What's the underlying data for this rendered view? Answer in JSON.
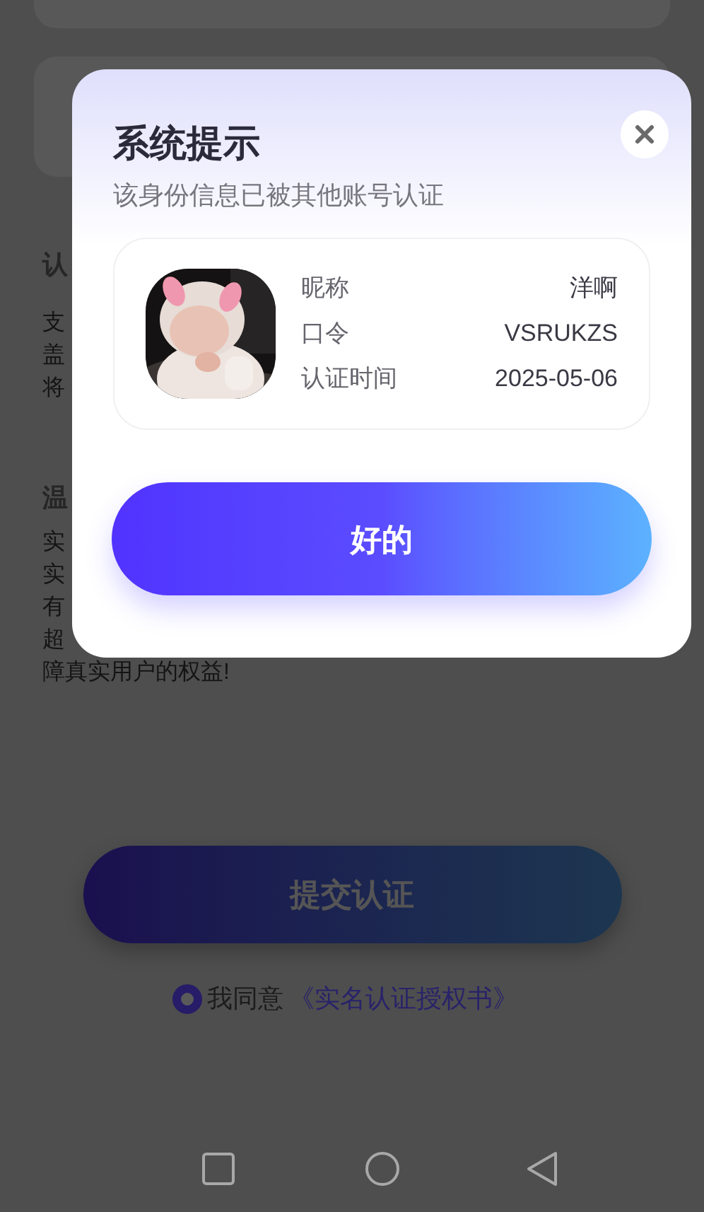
{
  "background": {
    "section_1": {
      "heading": "认",
      "lines": [
        "支",
        "盖",
        "将"
      ]
    },
    "section_2": {
      "heading": "温",
      "lines": [
        "实",
        "实",
        "有",
        "超",
        "障真实用户的权益!"
      ]
    },
    "submit_button": "提交认证",
    "agreement": {
      "checked": true,
      "text": "我同意",
      "link": "《实名认证授权书》"
    }
  },
  "dialog": {
    "title": "系统提示",
    "subtitle": "该身份信息已被其他账号认证",
    "account": {
      "fields": [
        {
          "label": "昵称",
          "value": "洋啊"
        },
        {
          "label": "口令",
          "value": "VSRUKZS"
        },
        {
          "label": "认证时间",
          "value": "2025-05-06"
        }
      ]
    },
    "confirm_button": "好的"
  }
}
